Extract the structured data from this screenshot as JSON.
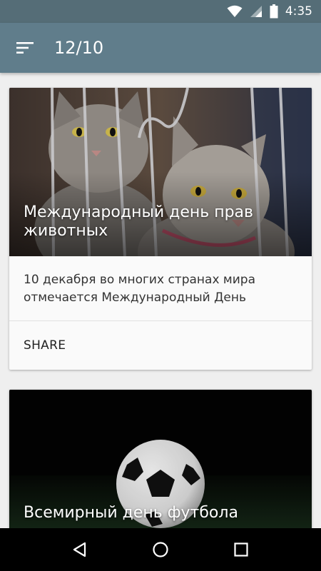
{
  "status_bar": {
    "time": "4:35"
  },
  "app_bar": {
    "title": "12/10"
  },
  "cards": [
    {
      "title": "Международный день прав животных",
      "text": "10 декабря во многих странах мира отмечается Международный День",
      "action_label": "SHARE"
    },
    {
      "title": "Всемирный день футбола"
    }
  ]
}
